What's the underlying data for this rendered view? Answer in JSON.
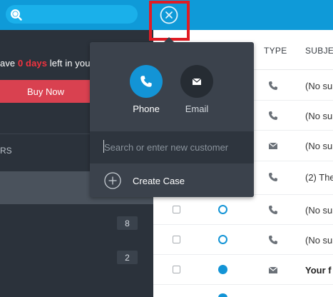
{
  "topbar": {
    "search_icon": "search-icon",
    "close_icon": "close-circle-icon",
    "bg_color": "#0f9ad8"
  },
  "sidebar": {
    "trial_prefix": "ave ",
    "trial_days": "0 days",
    "trial_suffix": " left in you",
    "buy_label": "Buy Now",
    "section_label": "RS",
    "counts": [
      "8",
      "2"
    ]
  },
  "table": {
    "headers": {
      "type": "TYPE",
      "subject": "SUBJEC"
    },
    "rows": [
      {
        "type_icon": "phone-icon",
        "subject": "(No su",
        "bold": false,
        "status": ""
      },
      {
        "type_icon": "phone-icon",
        "subject": "(No su",
        "bold": false,
        "status": ""
      },
      {
        "type_icon": "mail-icon",
        "subject": "(No su",
        "bold": false,
        "status": ""
      },
      {
        "type_icon": "phone-icon",
        "subject": "(2) The",
        "bold": false,
        "status": ""
      },
      {
        "type_icon": "phone-icon",
        "subject": "(No su",
        "bold": false,
        "status": "open"
      },
      {
        "type_icon": "phone-icon",
        "subject": "(No su",
        "bold": false,
        "status": "open"
      },
      {
        "type_icon": "mail-icon",
        "subject": "Your f",
        "bold": true,
        "status": "filled"
      }
    ]
  },
  "popover": {
    "phone_label": "Phone",
    "email_label": "Email",
    "search_placeholder": "Search or enter new customer",
    "create_label": "Create Case"
  },
  "colors": {
    "accent": "#0f9ad8",
    "buy_button": "#d94150",
    "trial_days": "#f2333f",
    "highlight": "#e01c24",
    "phone_circle": "#1394d6"
  }
}
